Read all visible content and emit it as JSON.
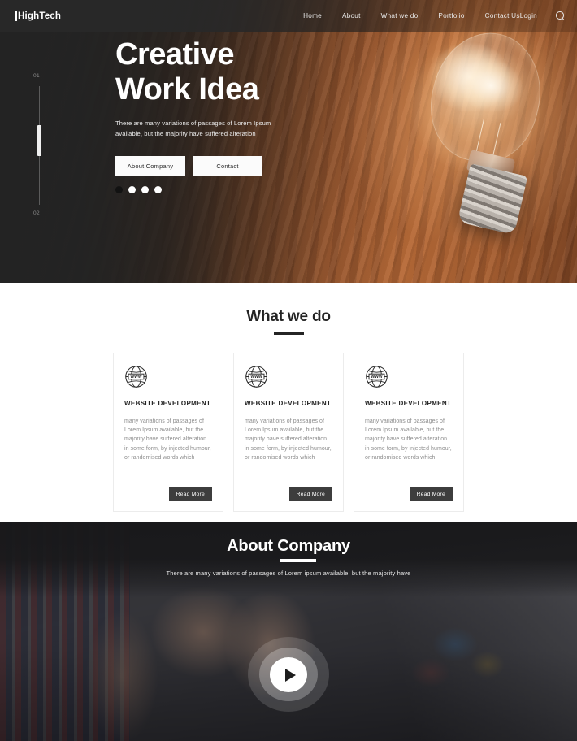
{
  "header": {
    "logo": {
      "text": "HighTech",
      "icon": "logo-bar-icon"
    },
    "nav": [
      {
        "label": "Home"
      },
      {
        "label": "About"
      },
      {
        "label": "What we do"
      },
      {
        "label": "Portfolio"
      },
      {
        "label": "Contact Us"
      }
    ],
    "login_label": "Login",
    "search_icon": "search-icon"
  },
  "hero": {
    "title_line1": "Creative",
    "title_line2": "Work Idea",
    "subtitle": "There are many variations of passages of Lorem Ipsum available, but the majority have suffered alteration",
    "buttons": [
      {
        "label": "About Company"
      },
      {
        "label": "Contact"
      }
    ],
    "dots": [
      {
        "active": true
      },
      {
        "active": false
      },
      {
        "active": false
      },
      {
        "active": false
      }
    ],
    "slider": {
      "number_top": "01",
      "number_bottom": "02"
    }
  },
  "services": {
    "title": "What we do",
    "cards": [
      {
        "icon": "globe-www-icon",
        "title": "Website Development",
        "body": "many variations of passages of Lorem Ipsum available, but the majority have suffered alteration in some form, by injected humour, or randomised words which",
        "button_label": "Read More"
      },
      {
        "icon": "globe-www-icon",
        "title": "Website Development",
        "body": "many variations of passages of Lorem Ipsum available, but the majority have suffered alteration in some form, by injected humour, or randomised words which",
        "button_label": "Read More"
      },
      {
        "icon": "globe-www-icon",
        "title": "Website Development",
        "body": "many variations of passages of Lorem Ipsum available, but the majority have suffered alteration in some form, by injected humour, or randomised words which",
        "button_label": "Read More"
      }
    ]
  },
  "about": {
    "title": "About Company",
    "subtitle": "There are many variations of passages of Lorem ipsum available, but the majority have",
    "play_icon": "play-icon"
  },
  "colors": {
    "dark": "#262626",
    "header_bg": "#282828",
    "accent_warm": "#b86b38",
    "text_dark": "#242424",
    "text_muted": "#8d8d8d",
    "button_dark": "#3d3d3d",
    "white": "#ffffff"
  }
}
